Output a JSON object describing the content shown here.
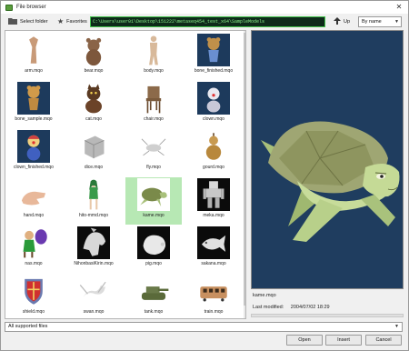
{
  "window": {
    "title": "File browser",
    "close_label": "✕"
  },
  "toolbar": {
    "select_folder_label": "Select folder",
    "favorites_label": "Favorites",
    "path": "C:\\Users\\user01\\Desktop\\151222\\metaseq454_test_x64\\SampleModels",
    "up_label": "Up",
    "sort_value": "By name"
  },
  "files": [
    {
      "name": "arm.mqo",
      "thumb": "arm-model-icon",
      "bg": "white"
    },
    {
      "name": "bear.mqo",
      "thumb": "bear-model-icon",
      "bg": "white"
    },
    {
      "name": "body.mqo",
      "thumb": "body-model-icon",
      "bg": "white"
    },
    {
      "name": "bone_finished.mqo",
      "thumb": "bone-finished-model-icon",
      "bg": "navy"
    },
    {
      "name": "bone_sample.mqo",
      "thumb": "bone-sample-model-icon",
      "bg": "navy"
    },
    {
      "name": "cat.mqo",
      "thumb": "cat-model-icon",
      "bg": "white"
    },
    {
      "name": "chair.mqo",
      "thumb": "chair-model-icon",
      "bg": "white"
    },
    {
      "name": "clown.mqo",
      "thumb": "clown-model-icon",
      "bg": "navy"
    },
    {
      "name": "clown_finished.mqo",
      "thumb": "clown-finished-model-icon",
      "bg": "navy"
    },
    {
      "name": "dice.mqo",
      "thumb": "dice-model-icon",
      "bg": "white"
    },
    {
      "name": "fly.mqo",
      "thumb": "fly-model-icon",
      "bg": "white"
    },
    {
      "name": "gourd.mqo",
      "thumb": "gourd-model-icon",
      "bg": "white"
    },
    {
      "name": "hand.mqo",
      "thumb": "hand-model-icon",
      "bg": "white"
    },
    {
      "name": "hito-mmd.mqo",
      "thumb": "hito-mmd-model-icon",
      "bg": "white"
    },
    {
      "name": "kame.mqo",
      "thumb": "kame-model-icon",
      "bg": "white",
      "selected": true
    },
    {
      "name": "meka.mqo",
      "thumb": "meka-model-icon",
      "bg": "dark"
    },
    {
      "name": "nas.mqo",
      "thumb": "nas-model-icon",
      "bg": "white"
    },
    {
      "name": "NihonbasiKirin.mqo",
      "thumb": "kirin-model-icon",
      "bg": "dark"
    },
    {
      "name": "pig.mqo",
      "thumb": "pig-model-icon",
      "bg": "dark"
    },
    {
      "name": "sakana.mqo",
      "thumb": "sakana-model-icon",
      "bg": "dark"
    },
    {
      "name": "shield.mqo",
      "thumb": "shield-model-icon",
      "bg": "white"
    },
    {
      "name": "swan.mqo",
      "thumb": "swan-model-icon",
      "bg": "white"
    },
    {
      "name": "tank.mqo",
      "thumb": "tank-model-icon",
      "bg": "white"
    },
    {
      "name": "train.mqo",
      "thumb": "train-model-icon",
      "bg": "white"
    }
  ],
  "preview": {
    "file_name": "kame.mqo",
    "last_modified_label": "Last modified:",
    "last_modified_value": "2004/07/02 18:29",
    "background_color": "#1f3d5f"
  },
  "filter": {
    "value": "All supported files"
  },
  "buttons": {
    "open": "Open",
    "insert": "Insert",
    "cancel": "Cancel"
  },
  "colors": {
    "selection": "#b7e8b4",
    "path_text": "#8af08a",
    "path_bg": "#0e2a1a"
  }
}
